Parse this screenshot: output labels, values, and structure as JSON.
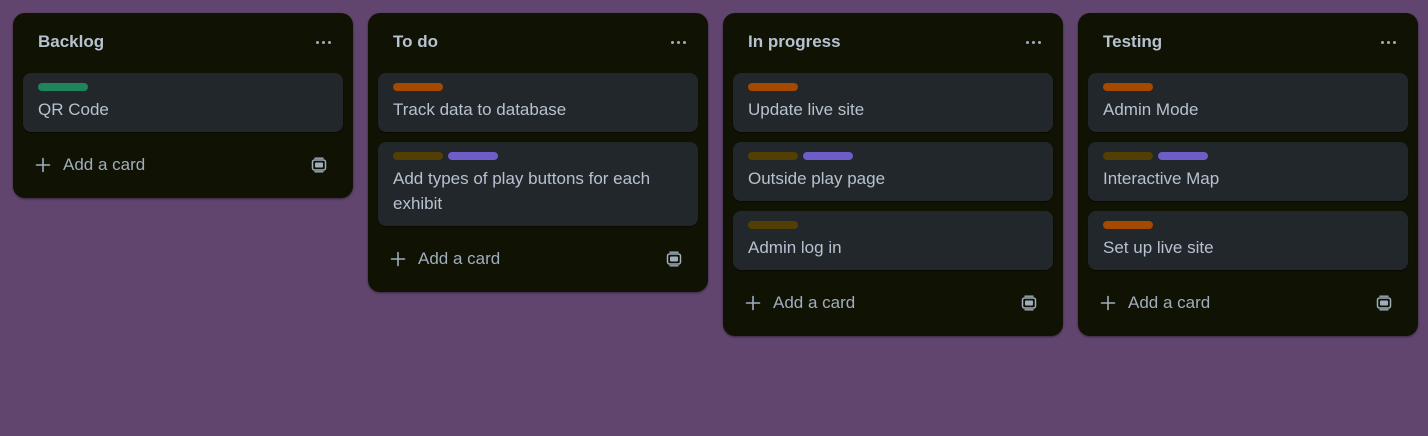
{
  "colors": {
    "background": "#61456f",
    "list_bg": "#101204",
    "card_bg": "#22272b",
    "text": "#b6c2cf",
    "muted": "#9fadbc",
    "label_green": "#1f845a",
    "label_orange": "#a54800",
    "label_yellow": "#533f04",
    "label_purple": "#6e5dc6"
  },
  "lists": [
    {
      "title": "Backlog",
      "menu_icon": "more-icon",
      "cards": [
        {
          "title": "QR Code",
          "labels": [
            "#1f845a"
          ]
        }
      ],
      "add_label": "Add a card",
      "template_icon": "card-template-icon"
    },
    {
      "title": "To do",
      "menu_icon": "more-icon",
      "cards": [
        {
          "title": "Track data to database",
          "labels": [
            "#a54800"
          ]
        },
        {
          "title": "Add types of play buttons for each exhibit",
          "labels": [
            "#533f04",
            "#6e5dc6"
          ]
        }
      ],
      "add_label": "Add a card",
      "template_icon": "card-template-icon"
    },
    {
      "title": "In progress",
      "menu_icon": "more-icon",
      "cards": [
        {
          "title": "Update live site",
          "labels": [
            "#a54800"
          ]
        },
        {
          "title": "Outside play page",
          "labels": [
            "#533f04",
            "#6e5dc6"
          ]
        },
        {
          "title": "Admin log in",
          "labels": [
            "#533f04"
          ]
        }
      ],
      "add_label": "Add a card",
      "template_icon": "card-template-icon"
    },
    {
      "title": "Testing",
      "menu_icon": "more-icon",
      "cards": [
        {
          "title": "Admin Mode",
          "labels": [
            "#a54800"
          ]
        },
        {
          "title": "Interactive Map",
          "labels": [
            "#533f04",
            "#6e5dc6"
          ]
        },
        {
          "title": "Set up live site",
          "labels": [
            "#a54800"
          ]
        }
      ],
      "add_label": "Add a card",
      "template_icon": "card-template-icon"
    }
  ]
}
